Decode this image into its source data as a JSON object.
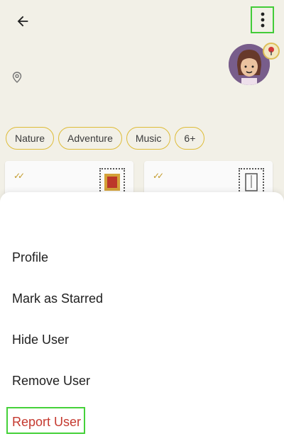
{
  "header": {
    "back_icon": "arrow-left-icon",
    "more_icon": "more-vertical-icon"
  },
  "profile": {
    "location_icon": "location-pin-icon"
  },
  "chips": [
    {
      "label": "Nature"
    },
    {
      "label": "Adventure"
    },
    {
      "label": "Music"
    },
    {
      "label": "6+"
    }
  ],
  "menu": {
    "items": [
      {
        "label": "Profile"
      },
      {
        "label": "Mark as Starred"
      },
      {
        "label": "Hide User"
      },
      {
        "label": "Remove User"
      },
      {
        "label": "Report User"
      }
    ]
  },
  "colors": {
    "accent": "#e3c03a",
    "danger": "#c5392f",
    "highlight": "#45d13a"
  }
}
